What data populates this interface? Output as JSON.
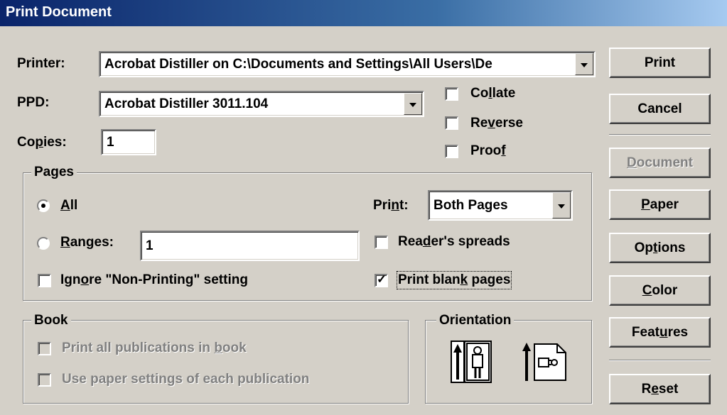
{
  "window": {
    "title": "Print Document"
  },
  "printer": {
    "label": "Printer:",
    "value": "Acrobat Distiller on C:\\Documents and Settings\\All Users\\De"
  },
  "ppd": {
    "label": "PPD:",
    "value": "Acrobat Distiller 3011.104"
  },
  "copies": {
    "label_pre": "Co",
    "label_u": "p",
    "label_post": "ies:",
    "value": "1"
  },
  "options": {
    "collate": {
      "pre": "Co",
      "u": "l",
      "post": "late",
      "checked": false
    },
    "reverse": {
      "pre": "Re",
      "u": "v",
      "post": "erse",
      "checked": false
    },
    "proof": {
      "pre": "Proo",
      "u": "f",
      "post": "",
      "checked": false
    }
  },
  "pages": {
    "legend": "Pages",
    "all": {
      "u": "A",
      "post": "ll",
      "selected": true
    },
    "ranges": {
      "u": "R",
      "post": "anges:",
      "value": "1",
      "selected": false
    },
    "ignore": {
      "pre": "Ign",
      "u": "o",
      "post": "re \"Non-Printing\" setting",
      "checked": false
    },
    "print": {
      "pre": "Pri",
      "u": "n",
      "post": "t:",
      "value": "Both Pages"
    },
    "readers": {
      "pre": "Rea",
      "u": "d",
      "post": "er's spreads",
      "checked": false
    },
    "blank": {
      "pre": "Print blan",
      "u": "k",
      "post": " pages",
      "checked": true
    }
  },
  "book": {
    "legend": "Book",
    "all_pubs": {
      "pre": "Print all publications in ",
      "u": "b",
      "post": "ook"
    },
    "paper_settings": {
      "pre": "Use paper settin",
      "u": "g",
      "post": "s of each publication"
    }
  },
  "orientation": {
    "legend": "Orientation",
    "selected": "portrait"
  },
  "buttons": {
    "print": "Print",
    "cancel": "Cancel",
    "document": {
      "u": "D",
      "post": "ocument"
    },
    "paper": {
      "u": "P",
      "post": "aper"
    },
    "options": {
      "pre": "Op",
      "u": "t",
      "post": "ions"
    },
    "color": {
      "u": "C",
      "post": "olor"
    },
    "features": {
      "pre": "Feat",
      "u": "u",
      "post": "res"
    },
    "reset": {
      "pre": "R",
      "u": "e",
      "post": "set"
    }
  }
}
